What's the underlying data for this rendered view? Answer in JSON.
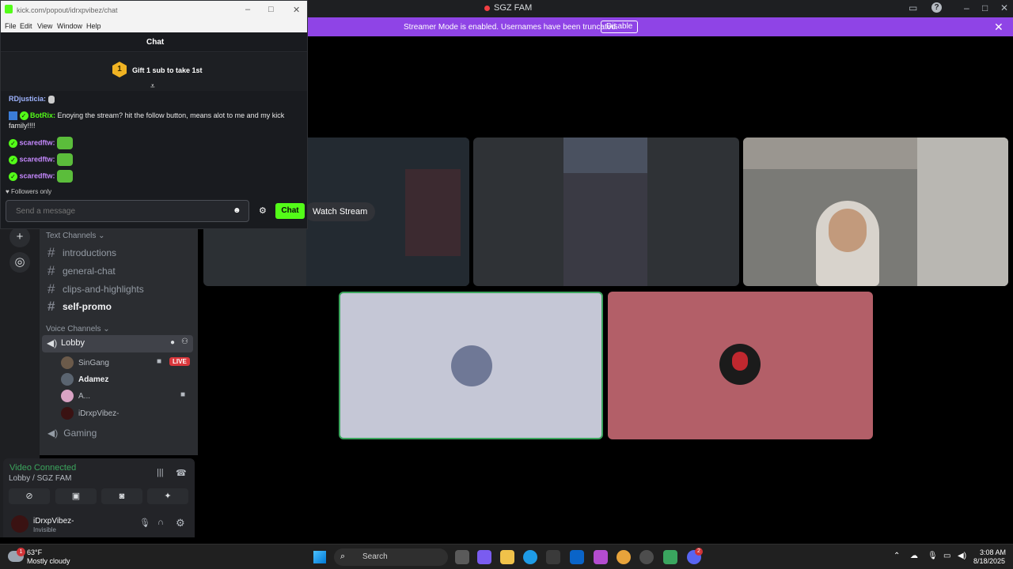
{
  "discord": {
    "window_title": "SGZ FAM",
    "banner": {
      "message": "Streamer Mode is enabled. Usernames have been truncated.",
      "button": "Disable"
    },
    "text_category": "Text Channels",
    "text_channels": [
      "introductions",
      "general-chat",
      "clips-and-highlights",
      "self-promo"
    ],
    "voice_category": "Voice Channels",
    "lobby": "Lobby",
    "voice_users": [
      "SinGang",
      "Adamez",
      "A...",
      "iDrxpVibez-"
    ],
    "live_badge": "LIVE",
    "gaming": "Gaming",
    "voice_status": "Video Connected",
    "voice_location": "Lobby / SGZ FAM",
    "username": "iDrxpVibez-",
    "user_status": "Invisible",
    "watch_stream": "Watch Stream"
  },
  "kick": {
    "url": "kick.com/popout/idrxpvibez/chat",
    "menu": [
      "File",
      "Edit",
      "View",
      "Window",
      "Help"
    ],
    "header": "Chat",
    "gift_rank": "1",
    "gift_text": "Gift 1 sub to take 1st",
    "messages": [
      {
        "user": "RDjusticia:",
        "text": ""
      },
      {
        "user": "BotRix:",
        "text": "Enoying the stream? hit the follow button, means alot to me and my kick family!!!!"
      },
      {
        "user": "scaredftw:",
        "text": ""
      },
      {
        "user": "scaredftw:",
        "text": ""
      },
      {
        "user": "scaredftw:",
        "text": ""
      }
    ],
    "followers_only": "Followers only",
    "input_placeholder": "Send a message",
    "chat_button": "Chat"
  },
  "taskbar": {
    "weather_temp": "63°F",
    "weather_desc": "Mostly cloudy",
    "weather_badge": "1",
    "search": "Search",
    "time": "3:08 AM",
    "date": "8/18/2025",
    "discord_badge": "2"
  }
}
